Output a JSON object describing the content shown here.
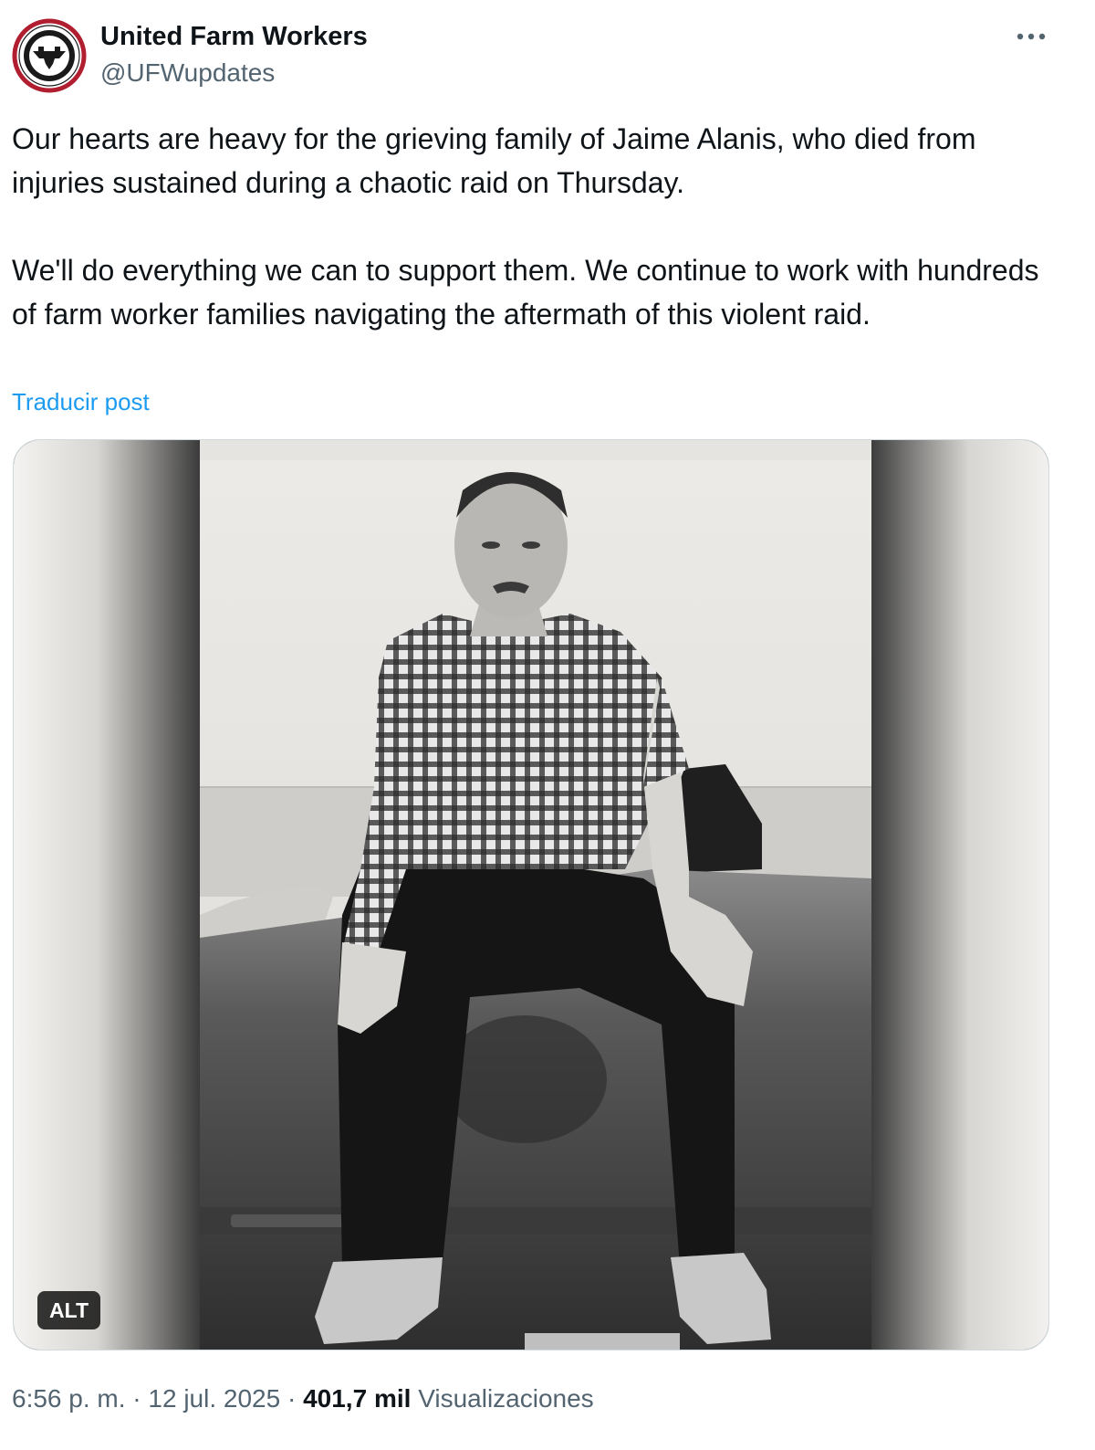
{
  "author": {
    "name": "United Farm Workers",
    "handle": "@UFWupdates",
    "avatar_icon": "ufw-eagle-logo-icon",
    "avatar_logo_text_top": "UNITED FARM WORKERS",
    "avatar_logo_text_bottom": "SI SE PUEDE"
  },
  "more_icon": "more-dots-icon",
  "tweet": {
    "paragraph_1": "Our hearts are heavy for the grieving family of Jaime Alanis, who died from injuries sustained during a chaotic raid on Thursday.",
    "paragraph_2": "We'll do everything we can to support them. We continue to work with hundreds of farm worker families navigating the aftermath of this violent raid.",
    "translate_label": "Traducir post"
  },
  "media": {
    "alt_label": "ALT"
  },
  "meta": {
    "time": "6:56 p. m.",
    "separator": "·",
    "date": "12 jul. 2025",
    "views_count": "401,7 mil",
    "views_label": "Visualizaciones"
  },
  "colors": {
    "link": "#1d9bf0",
    "secondary_text": "#536471",
    "primary_text": "#0f1419",
    "logo_red": "#b01e2f"
  }
}
